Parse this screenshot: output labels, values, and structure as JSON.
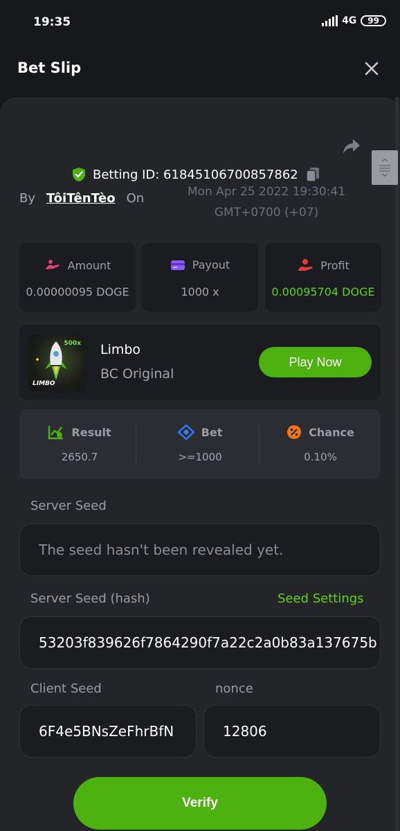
{
  "status_bar": {
    "time": "19:35",
    "network": "4G",
    "battery": "99"
  },
  "header": {
    "title": "Bet Slip"
  },
  "bet": {
    "id_label": "Betting ID: 61845106700857862",
    "by_label": "By",
    "username": "TôiTênTèo",
    "on_label": "On",
    "date_line1": "Mon Apr 25 2022 19:30:41",
    "date_line2": "GMT+0700 (+07)"
  },
  "stats": [
    {
      "label": "Amount",
      "value": "0.00000095 DOGE"
    },
    {
      "label": "Payout",
      "value": "1000 x"
    },
    {
      "label": "Profit",
      "value": "0.00095704 DOGE"
    }
  ],
  "game": {
    "name": "Limbo",
    "provider": "BC Original",
    "thumb_text": "LIMBO",
    "thumb_multiplier": "500x",
    "play_label": "Play Now"
  },
  "result": [
    {
      "label": "Result",
      "value": "2650.7"
    },
    {
      "label": "Bet",
      "value": ">=1000"
    },
    {
      "label": "Chance",
      "value": "0.10%"
    }
  ],
  "seeds": {
    "server_seed_label": "Server Seed",
    "server_seed_placeholder": "The seed hasn't been revealed yet.",
    "server_hash_label": "Server Seed (hash)",
    "seed_settings_label": "Seed Settings",
    "server_hash_value": "53203f839626f7864290f7a22c2a0b83a137675b",
    "client_seed_label": "Client Seed",
    "client_seed_value": "6F4e5BNsZeFhrBfN",
    "nonce_label": "nonce",
    "nonce_value": "12806"
  },
  "verify_label": "Verify",
  "colors": {
    "accent": "#4db10f",
    "profit": "#62d11b",
    "background": "#17181b",
    "panel": "#232529"
  }
}
